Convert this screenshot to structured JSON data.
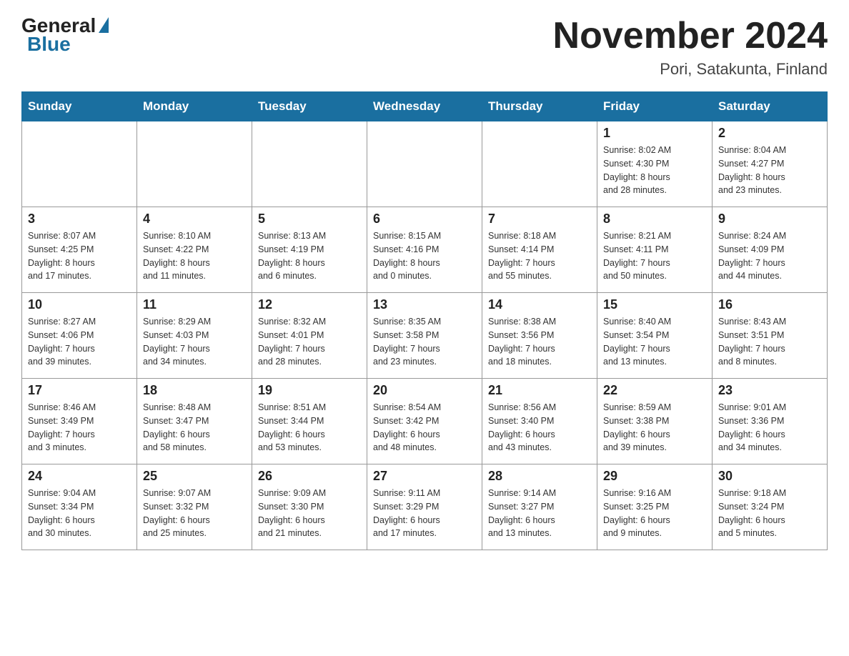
{
  "header": {
    "logo": {
      "general": "General",
      "blue": "Blue"
    },
    "title": "November 2024",
    "location": "Pori, Satakunta, Finland"
  },
  "days_of_week": [
    "Sunday",
    "Monday",
    "Tuesday",
    "Wednesday",
    "Thursday",
    "Friday",
    "Saturday"
  ],
  "weeks": [
    [
      {
        "day": "",
        "info": ""
      },
      {
        "day": "",
        "info": ""
      },
      {
        "day": "",
        "info": ""
      },
      {
        "day": "",
        "info": ""
      },
      {
        "day": "",
        "info": ""
      },
      {
        "day": "1",
        "info": "Sunrise: 8:02 AM\nSunset: 4:30 PM\nDaylight: 8 hours\nand 28 minutes."
      },
      {
        "day": "2",
        "info": "Sunrise: 8:04 AM\nSunset: 4:27 PM\nDaylight: 8 hours\nand 23 minutes."
      }
    ],
    [
      {
        "day": "3",
        "info": "Sunrise: 8:07 AM\nSunset: 4:25 PM\nDaylight: 8 hours\nand 17 minutes."
      },
      {
        "day": "4",
        "info": "Sunrise: 8:10 AM\nSunset: 4:22 PM\nDaylight: 8 hours\nand 11 minutes."
      },
      {
        "day": "5",
        "info": "Sunrise: 8:13 AM\nSunset: 4:19 PM\nDaylight: 8 hours\nand 6 minutes."
      },
      {
        "day": "6",
        "info": "Sunrise: 8:15 AM\nSunset: 4:16 PM\nDaylight: 8 hours\nand 0 minutes."
      },
      {
        "day": "7",
        "info": "Sunrise: 8:18 AM\nSunset: 4:14 PM\nDaylight: 7 hours\nand 55 minutes."
      },
      {
        "day": "8",
        "info": "Sunrise: 8:21 AM\nSunset: 4:11 PM\nDaylight: 7 hours\nand 50 minutes."
      },
      {
        "day": "9",
        "info": "Sunrise: 8:24 AM\nSunset: 4:09 PM\nDaylight: 7 hours\nand 44 minutes."
      }
    ],
    [
      {
        "day": "10",
        "info": "Sunrise: 8:27 AM\nSunset: 4:06 PM\nDaylight: 7 hours\nand 39 minutes."
      },
      {
        "day": "11",
        "info": "Sunrise: 8:29 AM\nSunset: 4:03 PM\nDaylight: 7 hours\nand 34 minutes."
      },
      {
        "day": "12",
        "info": "Sunrise: 8:32 AM\nSunset: 4:01 PM\nDaylight: 7 hours\nand 28 minutes."
      },
      {
        "day": "13",
        "info": "Sunrise: 8:35 AM\nSunset: 3:58 PM\nDaylight: 7 hours\nand 23 minutes."
      },
      {
        "day": "14",
        "info": "Sunrise: 8:38 AM\nSunset: 3:56 PM\nDaylight: 7 hours\nand 18 minutes."
      },
      {
        "day": "15",
        "info": "Sunrise: 8:40 AM\nSunset: 3:54 PM\nDaylight: 7 hours\nand 13 minutes."
      },
      {
        "day": "16",
        "info": "Sunrise: 8:43 AM\nSunset: 3:51 PM\nDaylight: 7 hours\nand 8 minutes."
      }
    ],
    [
      {
        "day": "17",
        "info": "Sunrise: 8:46 AM\nSunset: 3:49 PM\nDaylight: 7 hours\nand 3 minutes."
      },
      {
        "day": "18",
        "info": "Sunrise: 8:48 AM\nSunset: 3:47 PM\nDaylight: 6 hours\nand 58 minutes."
      },
      {
        "day": "19",
        "info": "Sunrise: 8:51 AM\nSunset: 3:44 PM\nDaylight: 6 hours\nand 53 minutes."
      },
      {
        "day": "20",
        "info": "Sunrise: 8:54 AM\nSunset: 3:42 PM\nDaylight: 6 hours\nand 48 minutes."
      },
      {
        "day": "21",
        "info": "Sunrise: 8:56 AM\nSunset: 3:40 PM\nDaylight: 6 hours\nand 43 minutes."
      },
      {
        "day": "22",
        "info": "Sunrise: 8:59 AM\nSunset: 3:38 PM\nDaylight: 6 hours\nand 39 minutes."
      },
      {
        "day": "23",
        "info": "Sunrise: 9:01 AM\nSunset: 3:36 PM\nDaylight: 6 hours\nand 34 minutes."
      }
    ],
    [
      {
        "day": "24",
        "info": "Sunrise: 9:04 AM\nSunset: 3:34 PM\nDaylight: 6 hours\nand 30 minutes."
      },
      {
        "day": "25",
        "info": "Sunrise: 9:07 AM\nSunset: 3:32 PM\nDaylight: 6 hours\nand 25 minutes."
      },
      {
        "day": "26",
        "info": "Sunrise: 9:09 AM\nSunset: 3:30 PM\nDaylight: 6 hours\nand 21 minutes."
      },
      {
        "day": "27",
        "info": "Sunrise: 9:11 AM\nSunset: 3:29 PM\nDaylight: 6 hours\nand 17 minutes."
      },
      {
        "day": "28",
        "info": "Sunrise: 9:14 AM\nSunset: 3:27 PM\nDaylight: 6 hours\nand 13 minutes."
      },
      {
        "day": "29",
        "info": "Sunrise: 9:16 AM\nSunset: 3:25 PM\nDaylight: 6 hours\nand 9 minutes."
      },
      {
        "day": "30",
        "info": "Sunrise: 9:18 AM\nSunset: 3:24 PM\nDaylight: 6 hours\nand 5 minutes."
      }
    ]
  ]
}
